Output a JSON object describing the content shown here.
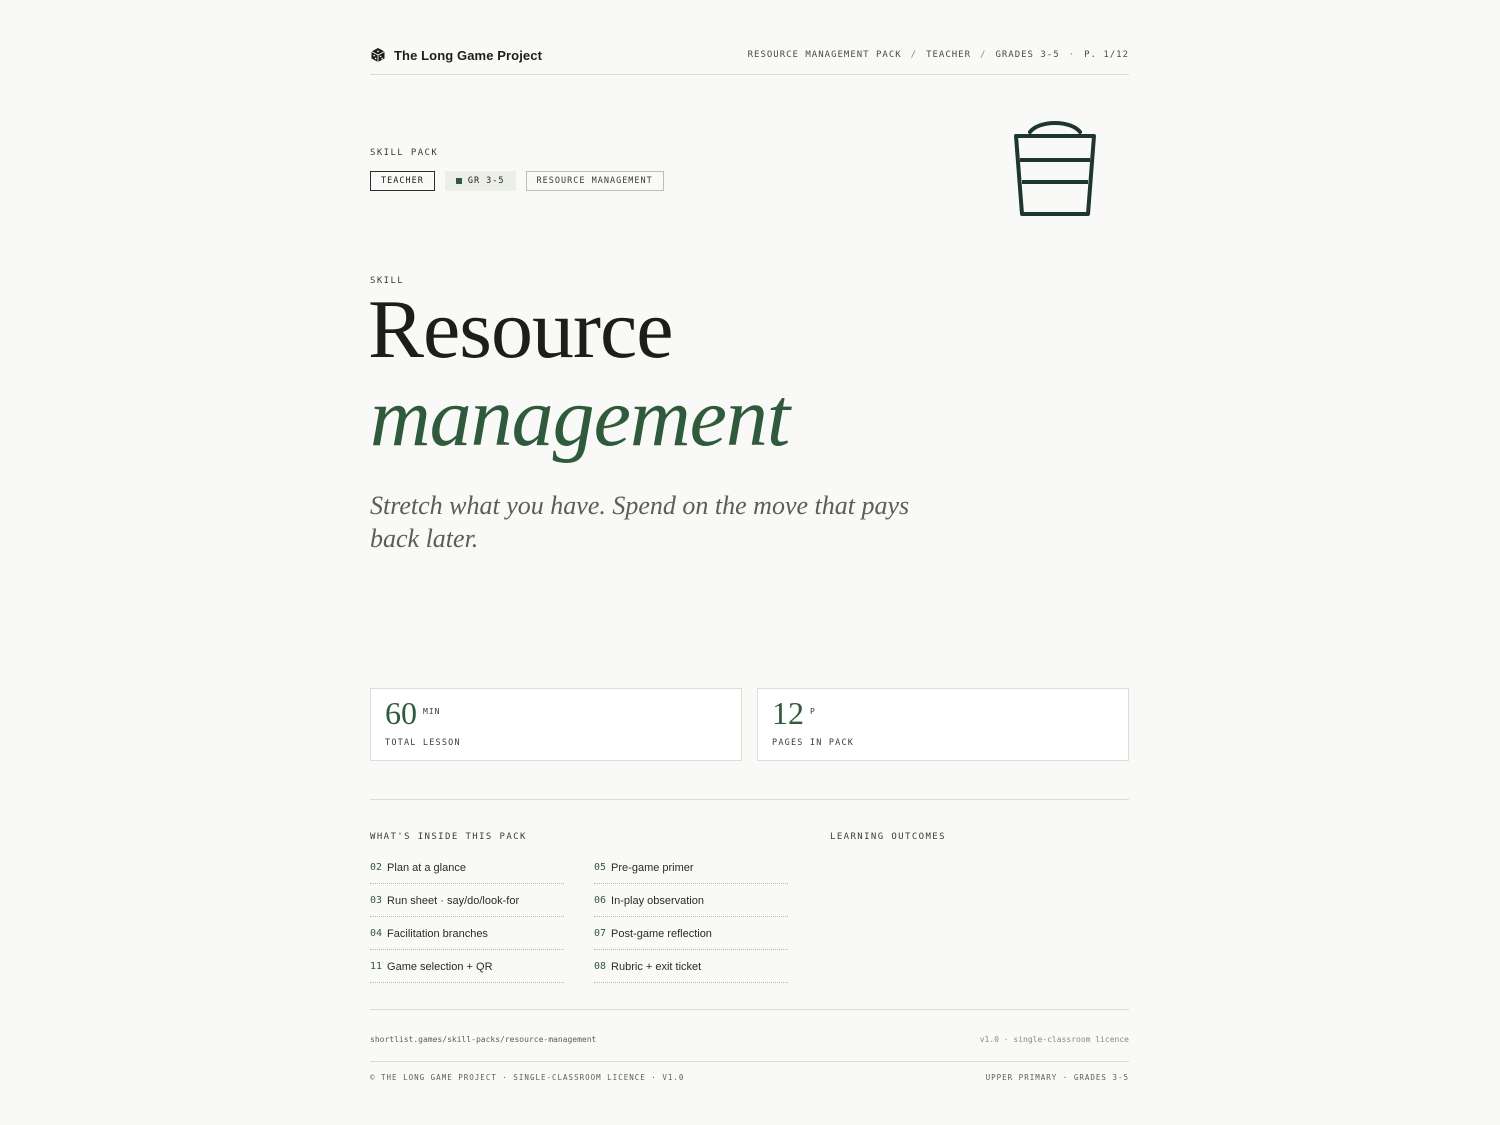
{
  "header": {
    "brand": "The Long Game Project",
    "brand_icon": "dice-icon",
    "crumbs": [
      "RESOURCE MANAGEMENT PACK",
      "TEACHER",
      "GRADES 3-5"
    ],
    "page": "P. 1/12"
  },
  "hero": {
    "eyebrow": "SKILL PACK",
    "tags": {
      "audience": "TEACHER",
      "grade": "Gr 3-5",
      "topic": "RESOURCE MANAGEMENT"
    },
    "illustration": "bucket-icon",
    "skill_label": "SKILL",
    "title_line1": "Resource",
    "title_line2": "management",
    "subtitle": "Stretch what you have. Spend on the move that pays back later."
  },
  "stats": [
    {
      "value": "60",
      "unit": "MIN",
      "label": "TOTAL LESSON"
    },
    {
      "value": "12",
      "unit": "P",
      "label": "PAGES IN PACK"
    }
  ],
  "contents": {
    "heading": "WHAT'S INSIDE THIS PACK",
    "items": [
      {
        "num": "02",
        "label": "Plan at a glance"
      },
      {
        "num": "05",
        "label": "Pre-game primer"
      },
      {
        "num": "03",
        "label": "Run sheet · say/do/look-for"
      },
      {
        "num": "06",
        "label": "In-play observation"
      },
      {
        "num": "04",
        "label": "Facilitation branches"
      },
      {
        "num": "07",
        "label": "Post-game reflection"
      },
      {
        "num": "11",
        "label": "Game selection + QR"
      },
      {
        "num": "08",
        "label": "Rubric + exit ticket"
      }
    ]
  },
  "outcomes": {
    "heading": "LEARNING OUTCOMES"
  },
  "footer": {
    "url": "shortlist.games/skill-packs/resource-management",
    "version": "v1.0 · single-classroom licence",
    "copyright": "© THE LONG GAME PROJECT · SINGLE-CLASSROOM LICENCE · V1.0",
    "audience": "UPPER PRIMARY · GRADES 3-5"
  },
  "colors": {
    "accent": "#2f5a3c",
    "ink": "#1d1d1b",
    "background": "#f9f9f7",
    "icon_stroke": "#1f3530"
  }
}
